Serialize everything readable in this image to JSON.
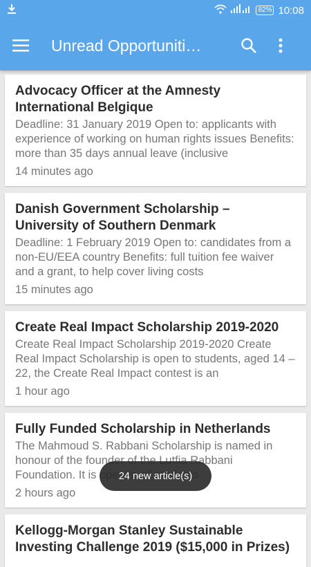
{
  "status_bar": {
    "time": "10:08",
    "battery": "82%"
  },
  "app_bar": {
    "title": "Unread Opportuniti…"
  },
  "articles": [
    {
      "title": "Advocacy Officer at the Amnesty International Belgique",
      "description": "Deadline: 31 January 2019 Open to: applicants with experience of working on human rights issues Benefits: more than 35 days annual leave (inclusive",
      "time": "14 minutes ago"
    },
    {
      "title": "Danish Government Scholarship – University of Southern Denmark",
      "description": "Deadline: 1 February 2019 Open to: candidates from a non-EU/EEA country Benefits: full tuition fee waiver and a grant, to help cover living costs",
      "time": "15 minutes ago"
    },
    {
      "title": "Create Real Impact Scholarship 2019-2020",
      "description": "Create Real Impact Scholarship 2019-2020 Create Real Impact Scholarship is open to students, aged 14 – 22, the Create Real Impact contest is an",
      "time": "1 hour ago"
    },
    {
      "title": "Fully Funded Scholarship in Netherlands",
      "description": "The Mahmoud S. Rabbani Scholarship is named in honour of the founder of the Lutfia Rabbani Foundation. It is open to all students",
      "time": "2 hours ago"
    },
    {
      "title": "Kellogg-Morgan Stanley Sustainable Investing Challenge 2019 ($15,000 in Prizes)",
      "description": "",
      "time": ""
    }
  ],
  "toast": {
    "text": "24 new article(s)"
  }
}
